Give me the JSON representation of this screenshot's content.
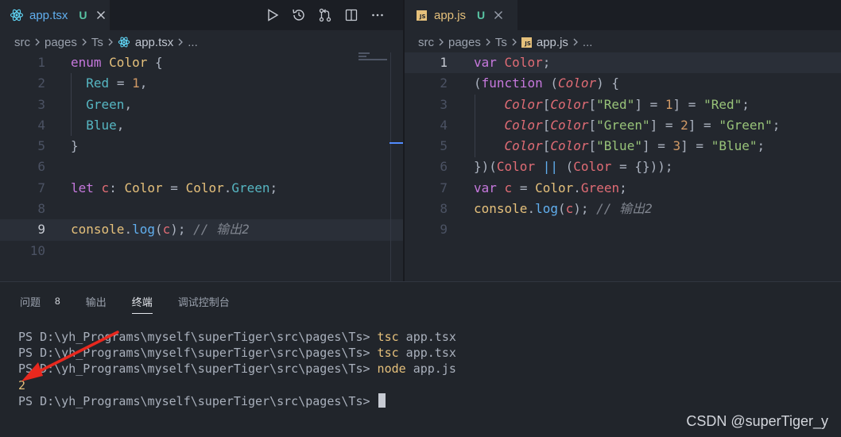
{
  "left_editor": {
    "tab": {
      "name": "app.tsx",
      "status": "U",
      "icon": "react-icon"
    },
    "actions": [
      "run-icon",
      "history-icon",
      "source-control-icon",
      "split-editor-icon",
      "more-actions-icon"
    ],
    "breadcrumb": {
      "folders": [
        "src",
        "pages",
        "Ts"
      ],
      "file": "app.tsx",
      "tail": "..."
    },
    "lines": [
      {
        "num": "1",
        "code": "enum Color {"
      },
      {
        "num": "2",
        "code": "  Red = 1,"
      },
      {
        "num": "3",
        "code": "  Green,"
      },
      {
        "num": "4",
        "code": "  Blue,"
      },
      {
        "num": "5",
        "code": "}"
      },
      {
        "num": "6",
        "code": ""
      },
      {
        "num": "7",
        "code": "let c: Color = Color.Green;"
      },
      {
        "num": "8",
        "code": ""
      },
      {
        "num": "9",
        "code": "console.log(c); // 输出2"
      },
      {
        "num": "10",
        "code": ""
      }
    ]
  },
  "right_editor": {
    "tab": {
      "name": "app.js",
      "status": "U",
      "icon": "js-file-icon"
    },
    "breadcrumb": {
      "folders": [
        "src",
        "pages",
        "Ts"
      ],
      "file": "app.js",
      "tail": "..."
    },
    "lines": [
      {
        "num": "1",
        "code": "var Color;"
      },
      {
        "num": "2",
        "code": "(function (Color) {"
      },
      {
        "num": "3",
        "code": "    Color[Color[\"Red\"] = 1] = \"Red\";"
      },
      {
        "num": "4",
        "code": "    Color[Color[\"Green\"] = 2] = \"Green\";"
      },
      {
        "num": "5",
        "code": "    Color[Color[\"Blue\"] = 3] = \"Blue\";"
      },
      {
        "num": "6",
        "code": "})(Color || (Color = {}));"
      },
      {
        "num": "7",
        "code": "var c = Color.Green;"
      },
      {
        "num": "8",
        "code": "console.log(c); // 输出2"
      },
      {
        "num": "9",
        "code": ""
      }
    ]
  },
  "panel": {
    "tabs": [
      {
        "label": "问题",
        "badge": "8"
      },
      {
        "label": "输出"
      },
      {
        "label": "终端",
        "active": true
      },
      {
        "label": "调试控制台"
      }
    ],
    "terminal": [
      {
        "prompt": "PS D:\\yh_Programs\\myself\\superTiger\\src\\pages\\Ts> ",
        "cmd": "tsc",
        "args": " app.tsx"
      },
      {
        "prompt": "PS D:\\yh_Programs\\myself\\superTiger\\src\\pages\\Ts> ",
        "cmd": "tsc",
        "args": " app.tsx"
      },
      {
        "prompt": "PS D:\\yh_Programs\\myself\\superTiger\\src\\pages\\Ts> ",
        "cmd": "node",
        "args": " app.js"
      },
      {
        "output": "2"
      },
      {
        "prompt": "PS D:\\yh_Programs\\myself\\superTiger\\src\\pages\\Ts> ",
        "cursor": true
      }
    ]
  },
  "watermark": "CSDN @superTiger_y",
  "colors": {
    "background": "#23272e",
    "accent": "#528bff",
    "arrow": "#e8281e"
  }
}
